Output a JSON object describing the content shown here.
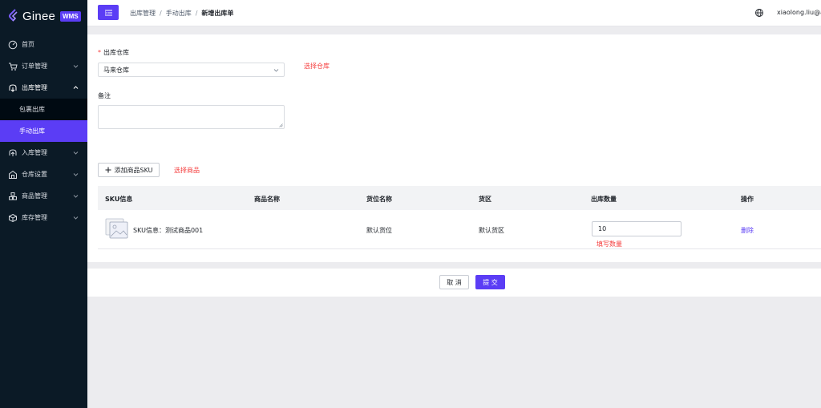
{
  "brand": {
    "name": "Ginee",
    "badge": "WMS",
    "accent": "#5b3df5"
  },
  "sidebar": {
    "items": [
      {
        "label": "首页",
        "icon": "dashboard-icon"
      },
      {
        "label": "订单管理",
        "icon": "cart-icon"
      },
      {
        "label": "出库管理",
        "icon": "outbound-icon"
      },
      {
        "label": "包裹出库"
      },
      {
        "label": "手动出库"
      },
      {
        "label": "入库管理",
        "icon": "inbound-icon"
      },
      {
        "label": "仓库设置",
        "icon": "warehouse-icon"
      },
      {
        "label": "商品管理",
        "icon": "product-icon"
      },
      {
        "label": "库存管理",
        "icon": "inventory-icon"
      }
    ]
  },
  "header": {
    "breadcrumb": [
      "出库管理",
      "手动出库",
      "新增出库单"
    ],
    "username": "xiaolong.liu@ac"
  },
  "form": {
    "warehouse_label": "出库仓库",
    "warehouse_value": "马来仓库",
    "warehouse_hint": "选择仓库",
    "remark_label": "备注",
    "add_sku_label": "添加商品SKU",
    "add_sku_hint": "选择商品"
  },
  "table": {
    "columns": [
      "SKU信息",
      "商品名称",
      "货位名称",
      "货区",
      "出库数量",
      "操作"
    ],
    "rows": [
      {
        "sku": "SKU信息：测试商品001",
        "product_name": "",
        "location": "默认货位",
        "zone": "默认货区",
        "qty": "10",
        "qty_hint": "填写数量",
        "action": "删除"
      }
    ]
  },
  "footer": {
    "cancel_label": "取 消",
    "submit_label": "提 交"
  }
}
